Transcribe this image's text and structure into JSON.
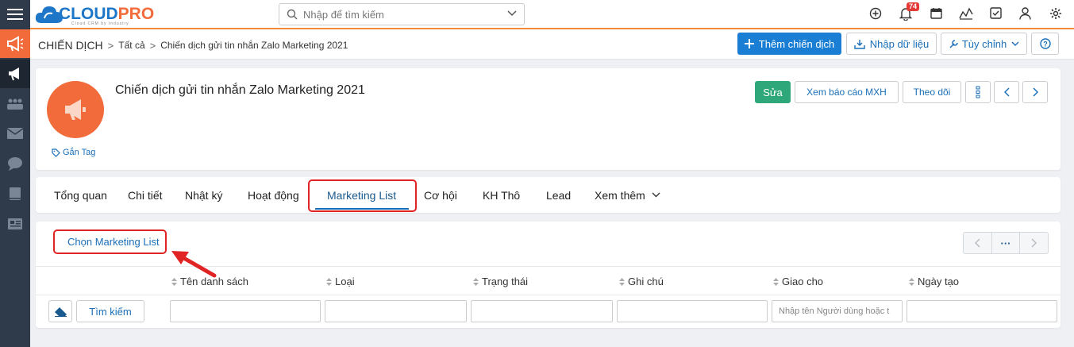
{
  "header": {
    "logo_text_a": "CLOUD",
    "logo_text_b": "PRO",
    "logo_sub": "Cloud CRM by Industry",
    "search_placeholder": "Nhập để tìm kiếm",
    "notification_count": "74",
    "icons": [
      "plus-circle-icon",
      "bell-icon",
      "calendar-icon",
      "chart-icon",
      "checkbox-icon",
      "user-icon",
      "gear-icon"
    ]
  },
  "sidebar": {
    "items": [
      "menu-icon",
      "megaphone-icon",
      "megaphone-icon",
      "people-icon",
      "mail-icon",
      "chat-icon",
      "book-icon",
      "newspaper-icon"
    ]
  },
  "breadcrumb": {
    "root": "CHIẾN DỊCH",
    "sep": ">",
    "level1": "Tất cả",
    "level2": "Chiến dịch gửi tin nhắn Zalo Marketing 2021"
  },
  "toolbar": {
    "add_label": "Thêm chiến dịch",
    "import_label": "Nhập dữ liệu",
    "customize_label": "Tùy chỉnh"
  },
  "record": {
    "title": "Chiến dịch gửi tin nhắn Zalo Marketing 2021",
    "tag_label": "Gắn Tag",
    "edit_label": "Sửa",
    "report_label": "Xem báo cáo MXH",
    "follow_label": "Theo dõi"
  },
  "tabs": [
    {
      "label": "Tổng quan"
    },
    {
      "label": "Chi tiết"
    },
    {
      "label": "Nhật ký"
    },
    {
      "label": "Hoạt động"
    },
    {
      "label": "Marketing List"
    },
    {
      "label": "Cơ hội"
    },
    {
      "label": "KH Thô"
    },
    {
      "label": "Lead"
    },
    {
      "label": "Xem thêm"
    }
  ],
  "active_tab": "Marketing List",
  "marketing_list": {
    "choose_label": "Chọn Marketing List",
    "pager_more": "···",
    "columns": [
      "Tên danh sách",
      "Loại",
      "Trạng thái",
      "Ghi chú",
      "Giao cho",
      "Ngày tạo"
    ],
    "search_label": "Tìm kiếm",
    "assignee_placeholder": "Nhập tên Người dùng hoặc t"
  },
  "colors": {
    "brand_orange": "#f26b3a",
    "brand_blue": "#1a7fd4",
    "edit_green": "#2ea87a",
    "highlight_red": "#e02424"
  }
}
